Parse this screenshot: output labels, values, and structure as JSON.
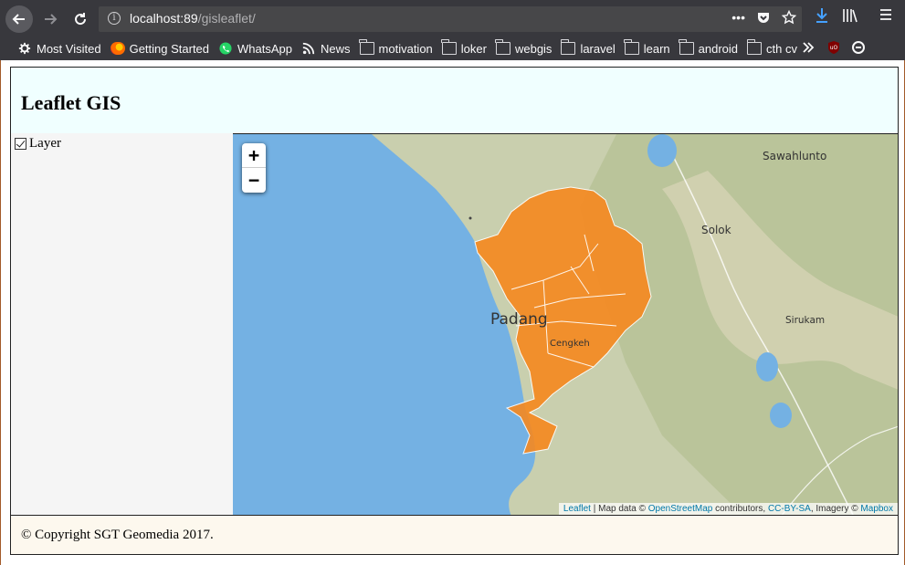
{
  "browser": {
    "url_host": "localhost:89",
    "url_path": "/gisleaflet/",
    "bookmarks": [
      {
        "label": "Most Visited",
        "icon": "gear-icon"
      },
      {
        "label": "Getting Started",
        "icon": "firefox-icon"
      },
      {
        "label": "WhatsApp",
        "icon": "whatsapp-icon"
      },
      {
        "label": "News",
        "icon": "rss-icon"
      },
      {
        "label": "motivation",
        "icon": "folder-icon"
      },
      {
        "label": "loker",
        "icon": "folder-icon"
      },
      {
        "label": "webgis",
        "icon": "folder-icon"
      },
      {
        "label": "laravel",
        "icon": "folder-icon"
      },
      {
        "label": "learn",
        "icon": "folder-icon"
      },
      {
        "label": "android",
        "icon": "folder-icon"
      },
      {
        "label": "cth cv",
        "icon": "folder-icon"
      }
    ]
  },
  "page": {
    "title": "Leaflet GIS",
    "footer": "© Copyright SGT Geomedia 2017.",
    "header_bg": "#f0ffff",
    "footer_bg": "#fdf8ee"
  },
  "sidebar": {
    "layer_label": "Layer",
    "layer_checked": true
  },
  "map": {
    "zoom_in": "+",
    "zoom_out": "−",
    "places": [
      "Sawahlunto",
      "Solok",
      "Padang",
      "Sirukam",
      "Cengkeh"
    ],
    "polygon_color": "#f6891f",
    "sea_color": "#74b1e3",
    "attribution": {
      "leaflet": "Leaflet",
      "sep1": " | Map data © ",
      "osm": "OpenStreetMap",
      "sep2": " contributors, ",
      "license": "CC-BY-SA",
      "sep3": ", Imagery © ",
      "mapbox": "Mapbox"
    }
  }
}
